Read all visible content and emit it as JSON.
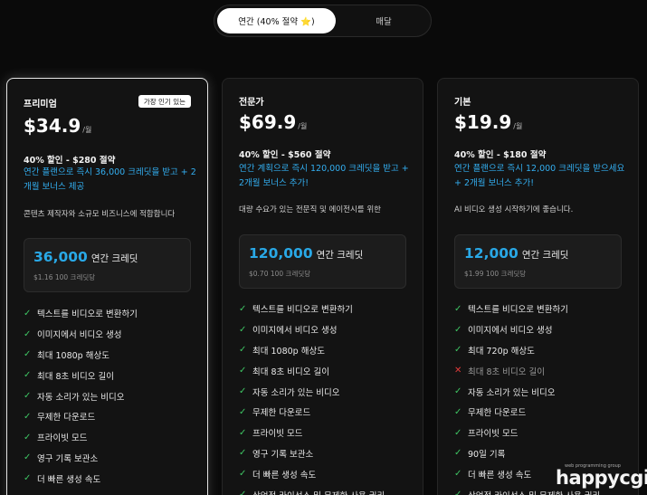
{
  "billing_toggle": {
    "annual_label": "연간 (40% 절약 ⭐)",
    "monthly_label": "매달"
  },
  "plans": [
    {
      "name": "프리미엄",
      "badge": "가장 인기 있는",
      "price": "$34.9",
      "unit": "/월",
      "discount": "40% 할인 - $280 절약",
      "promo": "연간 플랜으로 즉시 36,000 크레딧을 받고 + 2개월 보너스 제공",
      "description": "콘텐츠 제작자와 소규모 비즈니스에 적합합니다",
      "credits": {
        "amount": "36,000",
        "label": "연간 크레딧",
        "per": "$1.16 100 크레딧당"
      },
      "features": [
        {
          "text": "텍스트를 비디오로 변환하기",
          "included": true
        },
        {
          "text": "이미지에서 비디오 생성",
          "included": true
        },
        {
          "text": "최대 1080p 해상도",
          "included": true
        },
        {
          "text": "최대 8초 비디오 길이",
          "included": true
        },
        {
          "text": "자동 소리가 있는 비디오",
          "included": true
        },
        {
          "text": "무제한 다운로드",
          "included": true
        },
        {
          "text": "프라이빗 모드",
          "included": true
        },
        {
          "text": "영구 기록 보관소",
          "included": true
        },
        {
          "text": "더 빠른 생성 속도",
          "included": true
        }
      ]
    },
    {
      "name": "전문가",
      "badge": "",
      "price": "$69.9",
      "unit": "/월",
      "discount": "40% 할인 - $560 절약",
      "promo": "연간 계획으로 즉시 120,000 크레딧을 받고 + 2개월 보너스 추가!",
      "description": "대량 수요가 있는 전문직 및 에이전시를 위한",
      "credits": {
        "amount": "120,000",
        "label": "연간 크레딧",
        "per": "$0.70 100 크레딧당"
      },
      "features": [
        {
          "text": "텍스트를 비디오로 변환하기",
          "included": true
        },
        {
          "text": "이미지에서 비디오 생성",
          "included": true
        },
        {
          "text": "최대 1080p 해상도",
          "included": true
        },
        {
          "text": "최대 8초 비디오 길이",
          "included": true
        },
        {
          "text": "자동 소리가 있는 비디오",
          "included": true
        },
        {
          "text": "무제한 다운로드",
          "included": true
        },
        {
          "text": "프라이빗 모드",
          "included": true
        },
        {
          "text": "영구 기록 보관소",
          "included": true
        },
        {
          "text": "더 빠른 생성 속도",
          "included": true
        },
        {
          "text": "상업적 라이선스 및 무제한 사용 권리",
          "included": true
        }
      ]
    },
    {
      "name": "기본",
      "badge": "",
      "price": "$19.9",
      "unit": "/월",
      "discount": "40% 할인 - $180 절약",
      "promo": "연간 플랜으로 즉시 12,000 크레딧을 받으세요 + 2개월 보너스 추가!",
      "description": "AI 비디오 생성 시작하기에 좋습니다.",
      "credits": {
        "amount": "12,000",
        "label": "연간 크레딧",
        "per": "$1.99 100 크레딧당"
      },
      "features": [
        {
          "text": "텍스트를 비디오로 변환하기",
          "included": true
        },
        {
          "text": "이미지에서 비디오 생성",
          "included": true
        },
        {
          "text": "최대 720p 해상도",
          "included": true
        },
        {
          "text": "최대 8초 비디오 길이",
          "included": false
        },
        {
          "text": "자동 소리가 있는 비디오",
          "included": true
        },
        {
          "text": "무제한 다운로드",
          "included": true
        },
        {
          "text": "프라이빗 모드",
          "included": true
        },
        {
          "text": "90일 기록",
          "included": true
        },
        {
          "text": "더 빠른 생성 속도",
          "included": true
        },
        {
          "text": "상업적 라이선스 및 무제한 사용 권리",
          "included": true
        }
      ]
    }
  ],
  "watermark": {
    "tagline": "web programming group",
    "brand": "happycgi"
  },
  "colors": {
    "accent_blue": "#29a8e6",
    "check_green": "#3ec463",
    "cross_red": "#e03b3b",
    "background": "#0a0a0a"
  },
  "icons": {
    "check": "check-icon",
    "cross": "x-icon"
  }
}
